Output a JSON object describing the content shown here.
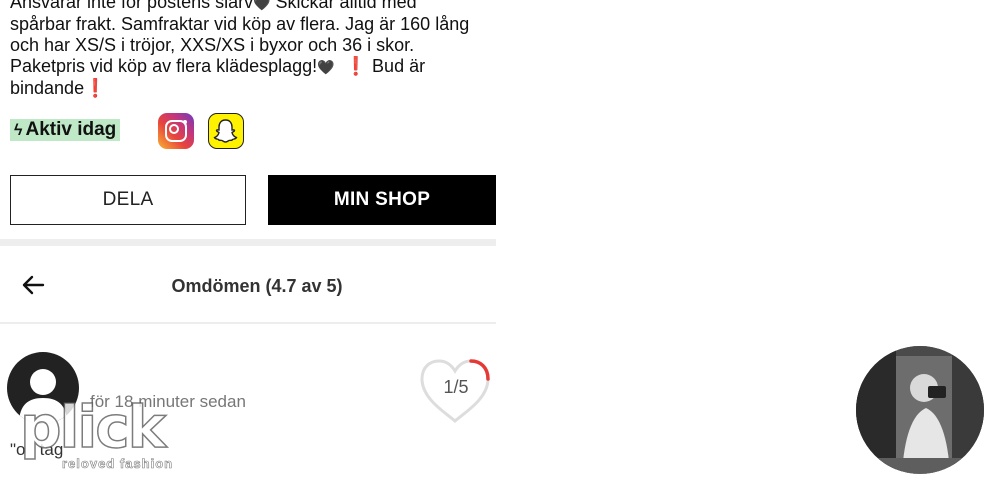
{
  "listing": {
    "description_line1": "Ansvarar inte för postens slarv",
    "description_line1_after": " Skickar alltid med",
    "description_line2": "spårbar frakt. Samfraktar vid köp av flera. Jag är 160 lång",
    "description_line3": "och har XS/S i tröjor, XXS/XS i byxor och 36 i skor.",
    "description_line4": "Paketpris vid köp av flera klädesplagg!",
    "description_line4_after": " Bud är",
    "description_line5": "bindande",
    "heart_glyph": "🖤",
    "exclamation_glyph": "❗"
  },
  "seller": {
    "active_label": "Aktiv idag",
    "active_icon": "lightning-icon",
    "social_icons": [
      "instagram-icon",
      "snapchat-icon"
    ]
  },
  "actions": {
    "share_label": "DELA",
    "shop_label": "MIN SHOP"
  },
  "reviews": {
    "title": "Omdömen (4.7 av 5)",
    "back_icon": "arrow-left-icon",
    "review": {
      "timestamp": "för 18 minuter sedan",
      "text_snippet": "\"o",
      "text_snippet_tail": "tag",
      "counter": "1/5"
    }
  },
  "watermark": {
    "word": "plick",
    "tagline": "reloved fashion"
  },
  "colors": {
    "active_badge_bg": "#bfe8c6",
    "shop_button_bg": "#000000",
    "progress_accent": "#e53935",
    "exclamation": "#e02020"
  }
}
